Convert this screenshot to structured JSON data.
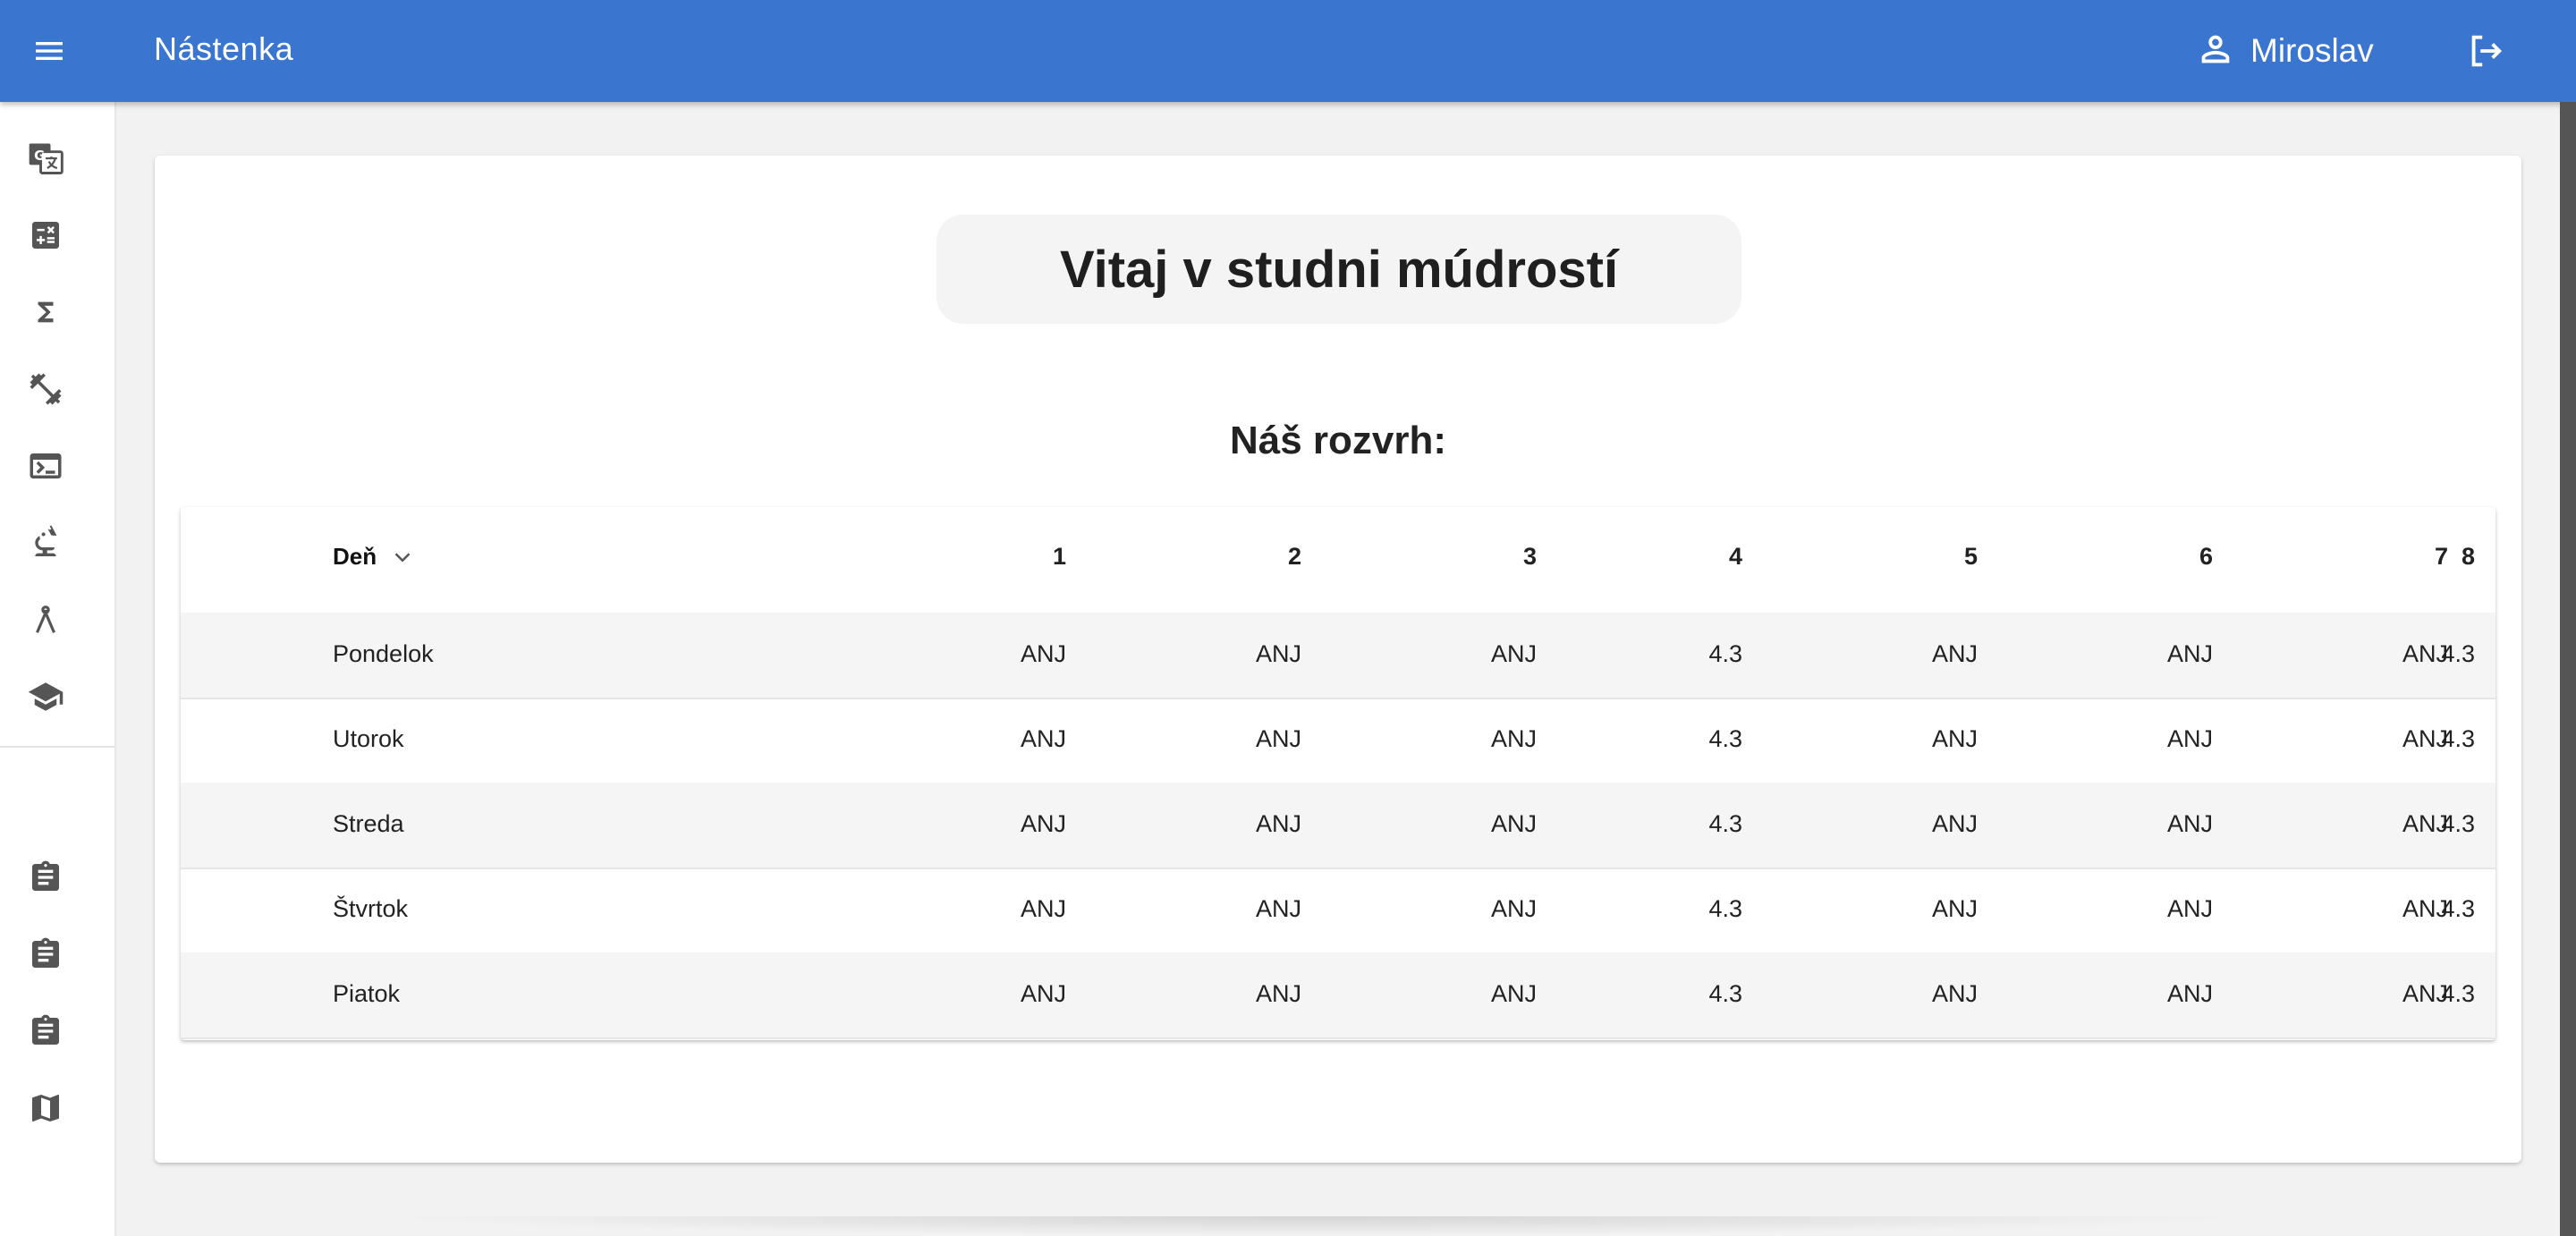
{
  "header": {
    "title": "Nástenka",
    "user_name": "Miroslav"
  },
  "sidebar": {
    "icons": [
      "translate-icon",
      "calculator-icon",
      "sigma-icon",
      "fitness-icon",
      "terminal-icon",
      "microscope-icon",
      "compass-icon",
      "school-icon"
    ],
    "lower_icons": [
      "assignment-icon",
      "assignment-icon",
      "assignment-icon",
      "map-icon"
    ]
  },
  "main": {
    "welcome": "Vitaj v studni múdrostí",
    "schedule_title": "Náš rozvrh:"
  },
  "table": {
    "headers": [
      "Deň",
      "1",
      "2",
      "3",
      "4",
      "5",
      "6",
      "7",
      "8"
    ],
    "rows": [
      [
        "Pondelok",
        "ANJ",
        "ANJ",
        "ANJ",
        "4.3",
        "ANJ",
        "ANJ",
        "ANJ",
        "4.3"
      ],
      [
        "Utorok",
        "ANJ",
        "ANJ",
        "ANJ",
        "4.3",
        "ANJ",
        "ANJ",
        "ANJ",
        "4.3"
      ],
      [
        "Streda",
        "ANJ",
        "ANJ",
        "ANJ",
        "4.3",
        "ANJ",
        "ANJ",
        "ANJ",
        "4.3"
      ],
      [
        "Štvrtok",
        "ANJ",
        "ANJ",
        "ANJ",
        "4.3",
        "ANJ",
        "ANJ",
        "ANJ",
        "4.3"
      ],
      [
        "Piatok",
        "ANJ",
        "ANJ",
        "ANJ",
        "4.3",
        "ANJ",
        "ANJ",
        "ANJ",
        "4.3"
      ]
    ]
  },
  "colors": {
    "primary": "#3a76cf",
    "background": "#f2f2f2",
    "row_alt": "#f5f5f5"
  }
}
